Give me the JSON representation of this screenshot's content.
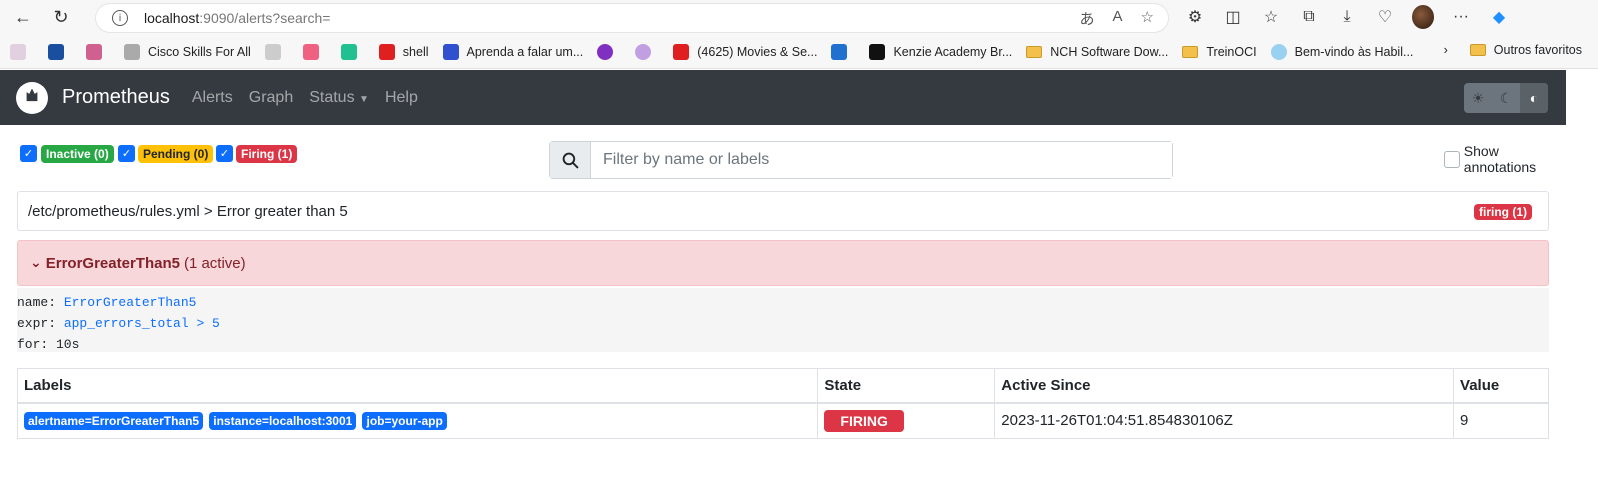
{
  "browser": {
    "url_host": "localhost",
    "url_rest": ":9090/alerts?search=",
    "bookmarks": [
      "Cisco Skills For All",
      "shell",
      "Aprenda a falar um...",
      "(4625) Movies & Se...",
      "Kenzie Academy Br...",
      "NCH Software Dow...",
      "TreinOCI",
      "Bem-vindo às Habil..."
    ],
    "other_favorites": "Outros favoritos"
  },
  "navbar": {
    "brand": "Prometheus",
    "links": [
      "Alerts",
      "Graph",
      "Status",
      "Help"
    ]
  },
  "filters": {
    "inactive": "Inactive (0)",
    "pending": "Pending (0)",
    "firing": "Firing (1)",
    "search_placeholder": "Filter by name or labels",
    "show_annotations": "Show annotations"
  },
  "rule_file": {
    "path": "/etc/prometheus/rules.yml > Error greater than 5",
    "badge": "firing (1)"
  },
  "alert": {
    "name": "ErrorGreaterThan5",
    "active": "(1 active)",
    "def_name_key": "name:",
    "def_name_val": "ErrorGreaterThan5",
    "def_expr_key": "expr:",
    "def_expr_val": "app_errors_total > 5",
    "def_for": "for: 10s"
  },
  "table": {
    "headers": [
      "Labels",
      "State",
      "Active Since",
      "Value"
    ],
    "rows": [
      {
        "labels": [
          "alertname=ErrorGreaterThan5",
          "instance=localhost:3001",
          "job=your-app"
        ],
        "state": "FIRING",
        "active_since": "2023-11-26T01:04:51.854830106Z",
        "value": "9"
      }
    ]
  },
  "colors": {
    "firing": "#dc3545",
    "inactive": "#28a745",
    "pending": "#ffc107",
    "label": "#0d6efd",
    "navbar": "#343a40"
  }
}
